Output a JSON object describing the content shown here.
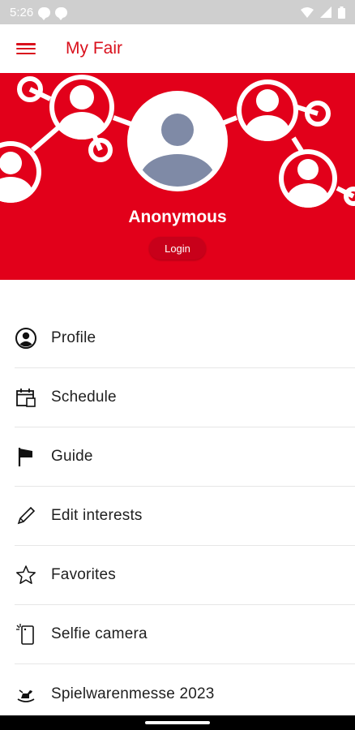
{
  "status_bar": {
    "time": "5:26"
  },
  "app_bar": {
    "title": "My Fair"
  },
  "profile": {
    "name": "Anonymous",
    "login_label": "Login"
  },
  "menu": {
    "items": [
      {
        "label": "Profile",
        "icon": "user-circle-icon"
      },
      {
        "label": "Schedule",
        "icon": "calendar-icon"
      },
      {
        "label": "Guide",
        "icon": "flag-icon"
      },
      {
        "label": "Edit interests",
        "icon": "pencil-icon"
      },
      {
        "label": "Favorites",
        "icon": "star-icon"
      },
      {
        "label": "Selfie camera",
        "icon": "phone-camera-icon"
      },
      {
        "label": "Spielwarenmesse 2023",
        "icon": "rocking-horse-icon"
      }
    ]
  },
  "colors": {
    "brand_red": "#e2001a",
    "title_red": "#d9101c"
  }
}
